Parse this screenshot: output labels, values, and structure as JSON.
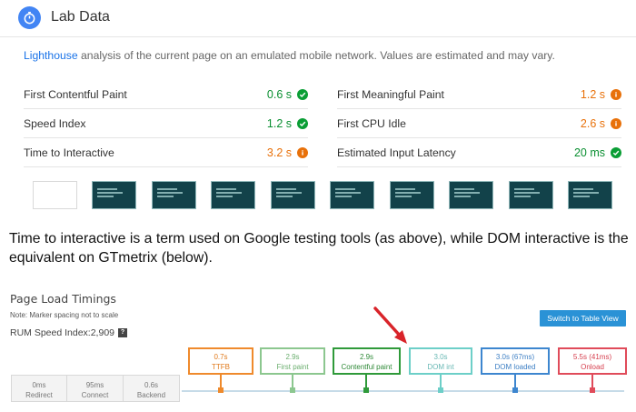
{
  "lab": {
    "title": "Lab Data",
    "link": "Lighthouse",
    "description": " analysis of the current page on an emulated mobile network. Values are estimated and may vary.",
    "metrics": [
      {
        "label": "First Contentful Paint",
        "value": "0.6 s",
        "status": "pass"
      },
      {
        "label": "First Meaningful Paint",
        "value": "1.2 s",
        "status": "average"
      },
      {
        "label": "Speed Index",
        "value": "1.2 s",
        "status": "pass"
      },
      {
        "label": "First CPU Idle",
        "value": "2.6 s",
        "status": "average"
      },
      {
        "label": "Time to Interactive",
        "value": "3.2 s",
        "status": "average"
      },
      {
        "label": "Estimated Input Latency",
        "value": "20 ms",
        "status": "pass"
      }
    ],
    "colors": {
      "pass": "#0a9e35",
      "average": "#e8710a",
      "pass_text": "#0a8f31",
      "average_text": "#e8710a"
    }
  },
  "caption": "Time to interactive is a term used on Google testing tools (as above), while DOM interactive is the equivalent on GTmetrix (below).",
  "gtmetrix": {
    "title": "Page Load Timings",
    "note": "Note: Marker spacing not to scale",
    "rum_label": "RUM Speed Index: ",
    "rum_value": "2,909",
    "rum_help": "?",
    "switch_button": "Switch to Table View",
    "base_segments": [
      {
        "time": "0ms",
        "label": "Redirect"
      },
      {
        "time": "95ms",
        "label": "Connect"
      },
      {
        "time": "0.6s",
        "label": "Backend"
      }
    ],
    "markers": [
      {
        "time": "0.7s",
        "label": "TTFB",
        "color": "#ef8a2c"
      },
      {
        "time": "2.9s",
        "label": "First paint",
        "color": "#8cc78f"
      },
      {
        "time": "2.9s",
        "label": "Contentful paint",
        "color": "#2f9a3a"
      },
      {
        "time": "3.0s",
        "label": "DOM int",
        "color": "#6dcfc8"
      },
      {
        "time": "3.0s (67ms)",
        "label": "DOM loaded",
        "color": "#3d86cf"
      },
      {
        "time": "5.5s (41ms)",
        "label": "Onload",
        "color": "#e04b5a"
      }
    ]
  }
}
